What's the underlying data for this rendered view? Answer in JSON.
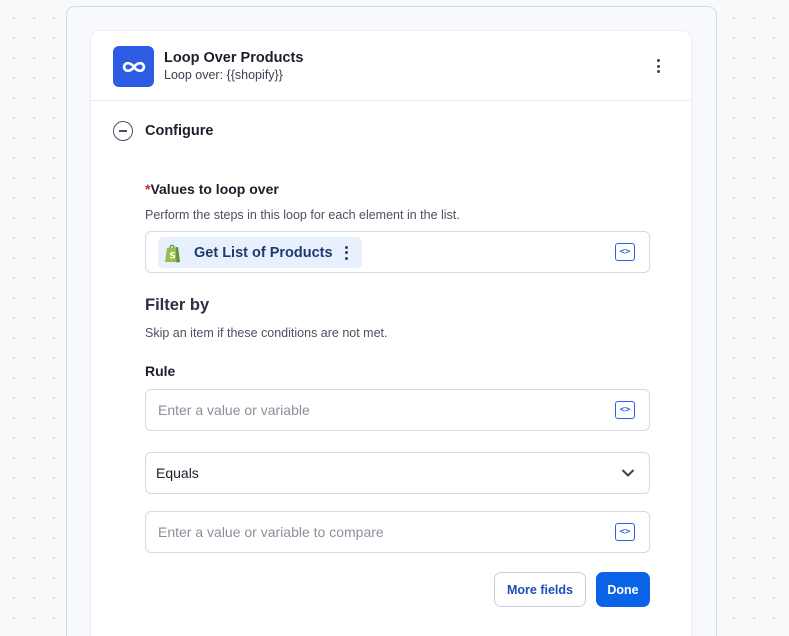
{
  "step": {
    "title": "Loop Over Products",
    "subtitle": "Loop over: {{shopify}}",
    "icon": "infinity-icon",
    "accent_color": "#2d5be3"
  },
  "configure": {
    "label": "Configure"
  },
  "values_field": {
    "required_marker": "*",
    "label": "Values to loop over",
    "help": "Perform the steps in this loop for each element in the list.",
    "chip_label": "Get List of Products",
    "chip_icon": "shopify-bag-icon"
  },
  "filter": {
    "title": "Filter by",
    "help": "Skip an item if these conditions are not met.",
    "rule_label": "Rule",
    "rule_placeholder": "Enter a value or variable",
    "operator_value": "Equals",
    "compare_placeholder": "Enter a value or variable to compare"
  },
  "buttons": {
    "more_fields": "More fields",
    "done": "Done",
    "primary_color": "#0b63e8"
  }
}
